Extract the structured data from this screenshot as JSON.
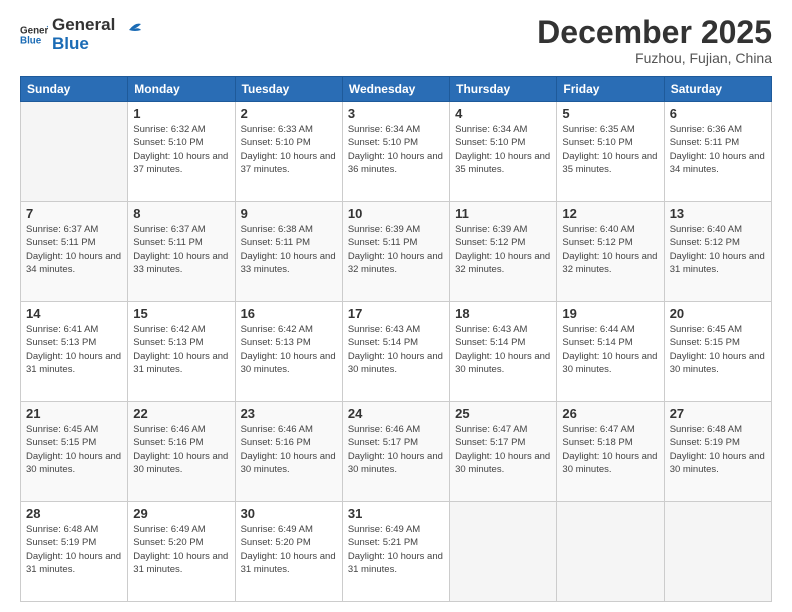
{
  "header": {
    "logo_general": "General",
    "logo_blue": "Blue",
    "month_title": "December 2025",
    "subtitle": "Fuzhou, Fujian, China"
  },
  "days_of_week": [
    "Sunday",
    "Monday",
    "Tuesday",
    "Wednesday",
    "Thursday",
    "Friday",
    "Saturday"
  ],
  "weeks": [
    [
      {
        "day": "",
        "empty": true
      },
      {
        "day": "1",
        "sunrise": "6:32 AM",
        "sunset": "5:10 PM",
        "daylight": "10 hours and 37 minutes."
      },
      {
        "day": "2",
        "sunrise": "6:33 AM",
        "sunset": "5:10 PM",
        "daylight": "10 hours and 37 minutes."
      },
      {
        "day": "3",
        "sunrise": "6:34 AM",
        "sunset": "5:10 PM",
        "daylight": "10 hours and 36 minutes."
      },
      {
        "day": "4",
        "sunrise": "6:34 AM",
        "sunset": "5:10 PM",
        "daylight": "10 hours and 35 minutes."
      },
      {
        "day": "5",
        "sunrise": "6:35 AM",
        "sunset": "5:10 PM",
        "daylight": "10 hours and 35 minutes."
      },
      {
        "day": "6",
        "sunrise": "6:36 AM",
        "sunset": "5:11 PM",
        "daylight": "10 hours and 34 minutes."
      }
    ],
    [
      {
        "day": "7",
        "sunrise": "6:37 AM",
        "sunset": "5:11 PM",
        "daylight": "10 hours and 34 minutes."
      },
      {
        "day": "8",
        "sunrise": "6:37 AM",
        "sunset": "5:11 PM",
        "daylight": "10 hours and 33 minutes."
      },
      {
        "day": "9",
        "sunrise": "6:38 AM",
        "sunset": "5:11 PM",
        "daylight": "10 hours and 33 minutes."
      },
      {
        "day": "10",
        "sunrise": "6:39 AM",
        "sunset": "5:11 PM",
        "daylight": "10 hours and 32 minutes."
      },
      {
        "day": "11",
        "sunrise": "6:39 AM",
        "sunset": "5:12 PM",
        "daylight": "10 hours and 32 minutes."
      },
      {
        "day": "12",
        "sunrise": "6:40 AM",
        "sunset": "5:12 PM",
        "daylight": "10 hours and 32 minutes."
      },
      {
        "day": "13",
        "sunrise": "6:40 AM",
        "sunset": "5:12 PM",
        "daylight": "10 hours and 31 minutes."
      }
    ],
    [
      {
        "day": "14",
        "sunrise": "6:41 AM",
        "sunset": "5:13 PM",
        "daylight": "10 hours and 31 minutes."
      },
      {
        "day": "15",
        "sunrise": "6:42 AM",
        "sunset": "5:13 PM",
        "daylight": "10 hours and 31 minutes."
      },
      {
        "day": "16",
        "sunrise": "6:42 AM",
        "sunset": "5:13 PM",
        "daylight": "10 hours and 30 minutes."
      },
      {
        "day": "17",
        "sunrise": "6:43 AM",
        "sunset": "5:14 PM",
        "daylight": "10 hours and 30 minutes."
      },
      {
        "day": "18",
        "sunrise": "6:43 AM",
        "sunset": "5:14 PM",
        "daylight": "10 hours and 30 minutes."
      },
      {
        "day": "19",
        "sunrise": "6:44 AM",
        "sunset": "5:14 PM",
        "daylight": "10 hours and 30 minutes."
      },
      {
        "day": "20",
        "sunrise": "6:45 AM",
        "sunset": "5:15 PM",
        "daylight": "10 hours and 30 minutes."
      }
    ],
    [
      {
        "day": "21",
        "sunrise": "6:45 AM",
        "sunset": "5:15 PM",
        "daylight": "10 hours and 30 minutes."
      },
      {
        "day": "22",
        "sunrise": "6:46 AM",
        "sunset": "5:16 PM",
        "daylight": "10 hours and 30 minutes."
      },
      {
        "day": "23",
        "sunrise": "6:46 AM",
        "sunset": "5:16 PM",
        "daylight": "10 hours and 30 minutes."
      },
      {
        "day": "24",
        "sunrise": "6:46 AM",
        "sunset": "5:17 PM",
        "daylight": "10 hours and 30 minutes."
      },
      {
        "day": "25",
        "sunrise": "6:47 AM",
        "sunset": "5:17 PM",
        "daylight": "10 hours and 30 minutes."
      },
      {
        "day": "26",
        "sunrise": "6:47 AM",
        "sunset": "5:18 PM",
        "daylight": "10 hours and 30 minutes."
      },
      {
        "day": "27",
        "sunrise": "6:48 AM",
        "sunset": "5:19 PM",
        "daylight": "10 hours and 30 minutes."
      }
    ],
    [
      {
        "day": "28",
        "sunrise": "6:48 AM",
        "sunset": "5:19 PM",
        "daylight": "10 hours and 31 minutes."
      },
      {
        "day": "29",
        "sunrise": "6:49 AM",
        "sunset": "5:20 PM",
        "daylight": "10 hours and 31 minutes."
      },
      {
        "day": "30",
        "sunrise": "6:49 AM",
        "sunset": "5:20 PM",
        "daylight": "10 hours and 31 minutes."
      },
      {
        "day": "31",
        "sunrise": "6:49 AM",
        "sunset": "5:21 PM",
        "daylight": "10 hours and 31 minutes."
      },
      {
        "day": "",
        "empty": true
      },
      {
        "day": "",
        "empty": true
      },
      {
        "day": "",
        "empty": true
      }
    ]
  ]
}
